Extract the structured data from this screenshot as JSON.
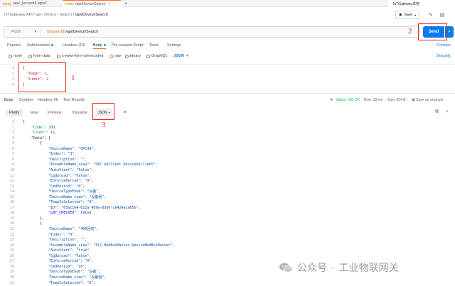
{
  "tabs": [
    {
      "method": "POST",
      "label": "/api/_Account/Login/L"
    },
    {
      "method": "POST",
      "label": "/api/Device/Search"
    }
  ],
  "environment": "IoTGateway本地",
  "breadcrumb": {
    "path": "IoTGateway API / api / Device / Search /",
    "current": "/api/Device/Search"
  },
  "toolbar": {
    "save_label": "Save"
  },
  "request": {
    "method": "POST",
    "url_var": "{{baseUrl}}",
    "url_path": "/api/Device/Search",
    "send_label": "Send"
  },
  "request_tabs": [
    "Params",
    "Authorization",
    "Headers (10)",
    "Body",
    "Pre-request Script",
    "Tests",
    "Settings"
  ],
  "cookies_link": "Cookies",
  "body_options": [
    "none",
    "form-data",
    "x-www-form-urlencoded",
    "raw",
    "binary",
    "GraphQL",
    "JSON"
  ],
  "beautify_label": "Beautify",
  "request_body": {
    "lines": [
      "{",
      "  \"Page\": 1,",
      "  \"Limit\": 2",
      "}"
    ]
  },
  "annotations": [
    "1",
    "2",
    "3"
  ],
  "response_tabs": [
    "Body",
    "Cookies",
    "Headers (4)",
    "Test Results"
  ],
  "response_status": {
    "status": "Status: 200 OK",
    "time": "Time: 29 ms",
    "size": "Size: 854 B",
    "save": "Save as example"
  },
  "format_tabs": [
    "Pretty",
    "Raw",
    "Preview",
    "Visualize",
    "JSON"
  ],
  "response_lines": [
    {
      "n": "1",
      "t": "{"
    },
    {
      "n": "2",
      "t": "    \"Code\": 200,"
    },
    {
      "n": "3",
      "t": "    \"Count\": 11,"
    },
    {
      "n": "4",
      "t": "    \"Data\": ["
    },
    {
      "n": "5",
      "t": "        {"
    },
    {
      "n": "6",
      "t": "            \"DeviceName\": \"OPCUA\","
    },
    {
      "n": "7",
      "t": "            \"Index\": \"3\","
    },
    {
      "n": "8",
      "t": "            \"Description\": \"\","
    },
    {
      "n": "9",
      "t": "            \"AssembleName_view\": \"OPC.UaClient.DeviceUaClient\","
    },
    {
      "n": "10",
      "t": "            \"AutoStart\": \"False\","
    },
    {
      "n": "11",
      "t": "            \"CgUpload\": \"False\","
    },
    {
      "n": "12",
      "t": "            \"EnforcePeriod\": \"0\","
    },
    {
      "n": "13",
      "t": "            \"CmdPeriod\": \"0\","
    },
    {
      "n": "14",
      "t": "            \"DeviceTypeEnum\": \"设备\","
    },
    {
      "n": "15",
      "t": "            \"DeviceName_view\": \"设备组\","
    },
    {
      "n": "16",
      "t": "            \"TempIsSelected\": \"0\","
    },
    {
      "n": "17",
      "t": "            \"ID\": \"05ac164-622a-489e-83d0-c6424a2a65b\","
    },
    {
      "n": "18",
      "t": "            \"LAY_CHECKED\": false"
    },
    {
      "n": "19",
      "t": "        },"
    },
    {
      "n": "20",
      "t": "        {"
    },
    {
      "n": "21",
      "t": "            \"DeviceName\": \"400回线\","
    },
    {
      "n": "22",
      "t": "            \"Index\": \"0\","
    },
    {
      "n": "23",
      "t": "            \"Description\": \"\","
    },
    {
      "n": "24",
      "t": "            \"AssembleName_view\": \"PLC.ModBusMaster.DeviceModBusMaster\","
    },
    {
      "n": "25",
      "t": "            \"AutoStart\": \"true\","
    },
    {
      "n": "26",
      "t": "            \"CgUpload\": \"False\","
    },
    {
      "n": "27",
      "t": "            \"EnforcePeriod\": \"0\","
    },
    {
      "n": "28",
      "t": "            \"CmdPeriod\": \"10\","
    },
    {
      "n": "29",
      "t": "            \"DeviceTypeEnum\": \"设备\","
    },
    {
      "n": "30",
      "t": "            \"DeviceName_view\": \"设备组\","
    },
    {
      "n": "31",
      "t": "            \"TempIsSelected\": \"0\","
    }
  ],
  "watermark": {
    "a": "公众号",
    "b": "工业物联网关"
  },
  "colors": {
    "accent": "#ff6c37",
    "send": "#097bed",
    "annotation": "#e5261e",
    "ok": "#0cbb52"
  }
}
